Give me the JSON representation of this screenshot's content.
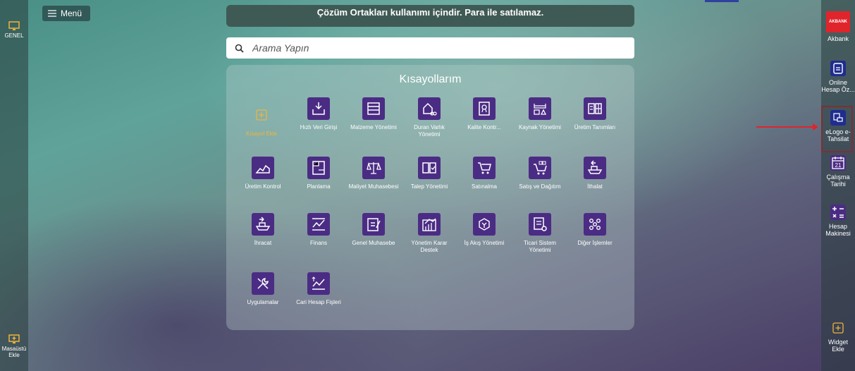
{
  "left_sidebar": {
    "genel_label": "GENEL",
    "desktop_add_label": "Masaüstü Ekle"
  },
  "menu_label": "Menü",
  "banner_text": "Çözüm Ortakları kullanımı içindir. Para ile satılamaz.",
  "search": {
    "placeholder": "Arama Yapın"
  },
  "shortcuts": {
    "title": "Kısayollarım",
    "add_label": "Kısayol Ekle",
    "tiles": [
      {
        "label": "Hızlı Veri Girişi",
        "icon": "data-import-icon"
      },
      {
        "label": "Malzeme Yönetimi",
        "icon": "material-icon"
      },
      {
        "label": "Duran Varlık Yönetimi",
        "icon": "fixed-asset-icon"
      },
      {
        "label": "Kalite Kontr...",
        "icon": "quality-icon"
      },
      {
        "label": "Kaynak Yönetimi",
        "icon": "resource-icon"
      },
      {
        "label": "Üretim Tanımları",
        "icon": "production-def-icon"
      },
      {
        "label": "Üretim Kontrol",
        "icon": "production-control-icon"
      },
      {
        "label": "Planlama",
        "icon": "planning-icon"
      },
      {
        "label": "Maliyet Muhasebesi",
        "icon": "cost-accounting-icon"
      },
      {
        "label": "Talep Yönetimi",
        "icon": "request-icon"
      },
      {
        "label": "Satınalma",
        "icon": "purchase-cart-icon"
      },
      {
        "label": "Satış ve Dağıtım",
        "icon": "sales-cart-icon"
      },
      {
        "label": "İthalat",
        "icon": "import-ship-icon"
      },
      {
        "label": "İhracat",
        "icon": "export-ship-icon"
      },
      {
        "label": "Finans",
        "icon": "finance-chart-icon"
      },
      {
        "label": "Genel Muhasebe",
        "icon": "ledger-icon"
      },
      {
        "label": "Yönetim Karar Destek",
        "icon": "decision-support-icon"
      },
      {
        "label": "İş Akış Yönetimi",
        "icon": "workflow-icon"
      },
      {
        "label": "Ticari Sistem Yönetimi",
        "icon": "system-settings-icon"
      },
      {
        "label": "Diğer İşlemler",
        "icon": "other-dots-icon"
      },
      {
        "label": "Uygulamalar",
        "icon": "tools-icon"
      },
      {
        "label": "Cari Hesap Fişleri",
        "icon": "account-slip-icon"
      }
    ]
  },
  "right_sidebar": {
    "akbank_logo": "AKBANK",
    "akbank_label": "Akbank",
    "online_label": "Online Hesap Öz...",
    "elogo_label": "eLogo e-Tahsilat",
    "calendar_day": "21",
    "calendar_label": "Çalışma Tarihi",
    "calculator_label": "Hesap Makinesi",
    "widget_label": "Widget Ekle"
  },
  "colors": {
    "tile_bg": "#4b2c84",
    "add_accent": "#f0b43c",
    "highlight": "#e0242c",
    "akbank_red": "#e0242c",
    "elogo_blue": "#1f2d8f"
  }
}
